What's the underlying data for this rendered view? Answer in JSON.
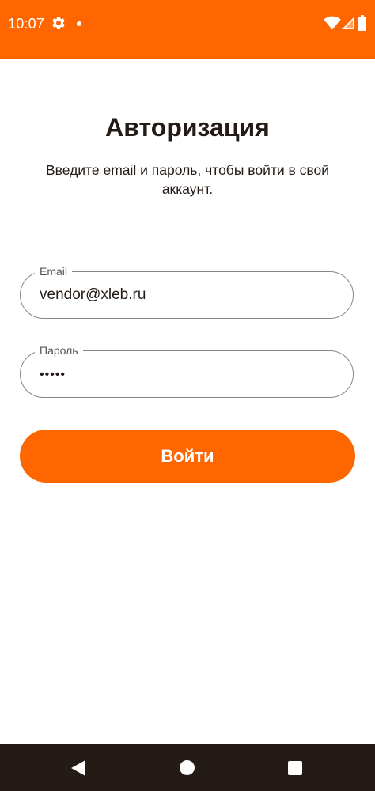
{
  "status_bar": {
    "time": "10:07",
    "icons": [
      "gear-icon",
      "notification-dot-icon",
      "wifi-icon",
      "signal-icon",
      "battery-icon"
    ],
    "background": "#ff6600"
  },
  "login": {
    "title": "Авторизация",
    "subtitle": "Введите email и пароль, чтобы войти в свой аккаунт.",
    "email_label": "Email",
    "email_value": "vendor@xleb.ru",
    "password_label": "Пароль",
    "password_value": "•••••",
    "submit_label": "Войти"
  },
  "nav_bar": {
    "icons": [
      "back-icon",
      "home-icon",
      "recents-icon"
    ],
    "background": "#241a16"
  },
  "colors": {
    "accent": "#ff6600",
    "text": "#241a16"
  }
}
